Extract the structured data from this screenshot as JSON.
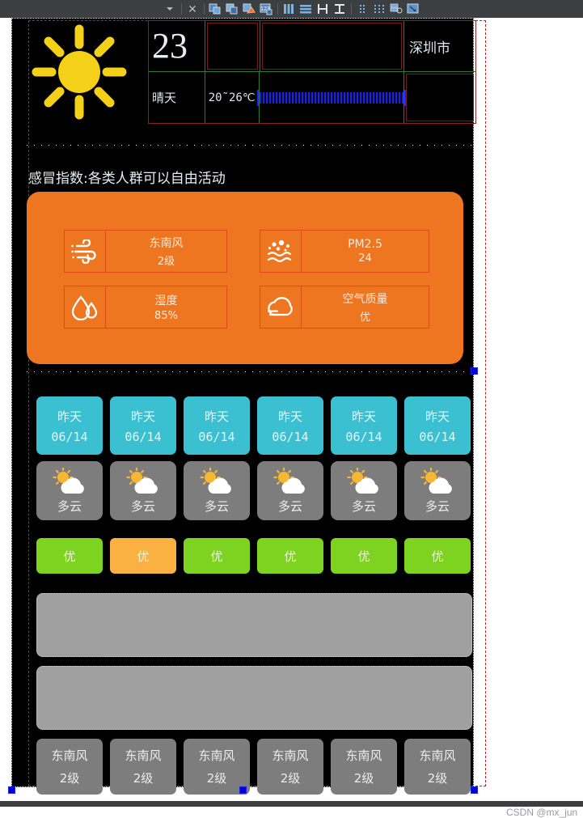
{
  "toolbar": {
    "buttons": [
      {
        "name": "dropdown-caret",
        "icon": "caret-down-icon",
        "label": ""
      },
      {
        "name": "close-button",
        "icon": "close-x-icon",
        "label": ""
      },
      {
        "name": "align-left-button",
        "icon": "align-left-icon",
        "label": ""
      },
      {
        "name": "align-right-button",
        "icon": "align-right-icon",
        "label": ""
      },
      {
        "name": "align-shape-button",
        "icon": "align-shape-icon",
        "label": ""
      },
      {
        "name": "numbering-button",
        "icon": "numbering-123-icon",
        "label": ""
      },
      {
        "name": "columns-button",
        "icon": "columns-icon",
        "label": ""
      },
      {
        "name": "rows-button",
        "icon": "rows-icon",
        "label": ""
      },
      {
        "name": "distribute-horizontal-button",
        "icon": "distribute-horizontal-icon",
        "label": ""
      },
      {
        "name": "distribute-vertical-button",
        "icon": "distribute-vertical-icon",
        "label": ""
      },
      {
        "name": "grid-2col-button",
        "icon": "grid-2col-icon",
        "label": ""
      },
      {
        "name": "grid-3col-button",
        "icon": "grid-3col-icon",
        "label": ""
      },
      {
        "name": "group-button",
        "icon": "group-layers-icon",
        "label": ""
      },
      {
        "name": "resize-button",
        "icon": "resize-diagonal-icon",
        "label": ""
      }
    ]
  },
  "weather": {
    "icon": "sun-icon",
    "temperature": "23",
    "condition": "晴天",
    "range": "20˜26℃",
    "city": "深圳市",
    "bar": "striped-progress-bar"
  },
  "flu_index": "感冒指数:各类人群可以自由活动",
  "panel": {
    "metrics": [
      {
        "icon": "wind-icon",
        "line1": "东南风",
        "line2": "2级"
      },
      {
        "icon": "pm25-icon",
        "line1": "PM2.5",
        "line2": "24"
      },
      {
        "icon": "humidity-icon",
        "line1": "湿度",
        "line2": "85%"
      },
      {
        "icon": "air-quality-icon",
        "line1": "空气质量",
        "line2": "优"
      }
    ]
  },
  "forecast": {
    "days": [
      {
        "label": "昨天",
        "date": "06/14"
      },
      {
        "label": "昨天",
        "date": "06/14"
      },
      {
        "label": "昨天",
        "date": "06/14"
      },
      {
        "label": "昨天",
        "date": "06/14"
      },
      {
        "label": "昨天",
        "date": "06/14"
      },
      {
        "label": "昨天",
        "date": "06/14"
      }
    ],
    "conditions": [
      {
        "icon": "sun-cloud-icon",
        "text": "多云"
      },
      {
        "icon": "sun-cloud-icon",
        "text": "多云"
      },
      {
        "icon": "sun-cloud-icon",
        "text": "多云"
      },
      {
        "icon": "sun-cloud-icon",
        "text": "多云"
      },
      {
        "icon": "sun-cloud-icon",
        "text": "多云"
      },
      {
        "icon": "sun-cloud-icon",
        "text": "多云"
      }
    ],
    "aqi": [
      {
        "text": "优",
        "color": "#7ed321"
      },
      {
        "text": "优",
        "color": "#fbb042"
      },
      {
        "text": "优",
        "color": "#7ed321"
      },
      {
        "text": "优",
        "color": "#7ed321"
      },
      {
        "text": "优",
        "color": "#7ed321"
      },
      {
        "text": "优",
        "color": "#7ed321"
      }
    ],
    "winds": [
      {
        "dir": "东南风",
        "level": "2级"
      },
      {
        "dir": "东南风",
        "level": "2级"
      },
      {
        "dir": "东南风",
        "level": "2级"
      },
      {
        "dir": "东南风",
        "level": "2级"
      },
      {
        "dir": "东南风",
        "level": "2级"
      },
      {
        "dir": "东南风",
        "level": "2级"
      }
    ]
  },
  "watermark": "CSDN @mx_jun",
  "colors": {
    "background": "#000000",
    "panel_orange": "#ee7620",
    "day_cyan": "#3bc0d2",
    "cond_gray": "#7d7d7d",
    "aqi_green": "#7ed321",
    "aqi_orange": "#fbb042",
    "placeholder_gray": "#a0a0a0",
    "sun_yellow": "#f5d018",
    "toolbar": "#3c3f41"
  }
}
